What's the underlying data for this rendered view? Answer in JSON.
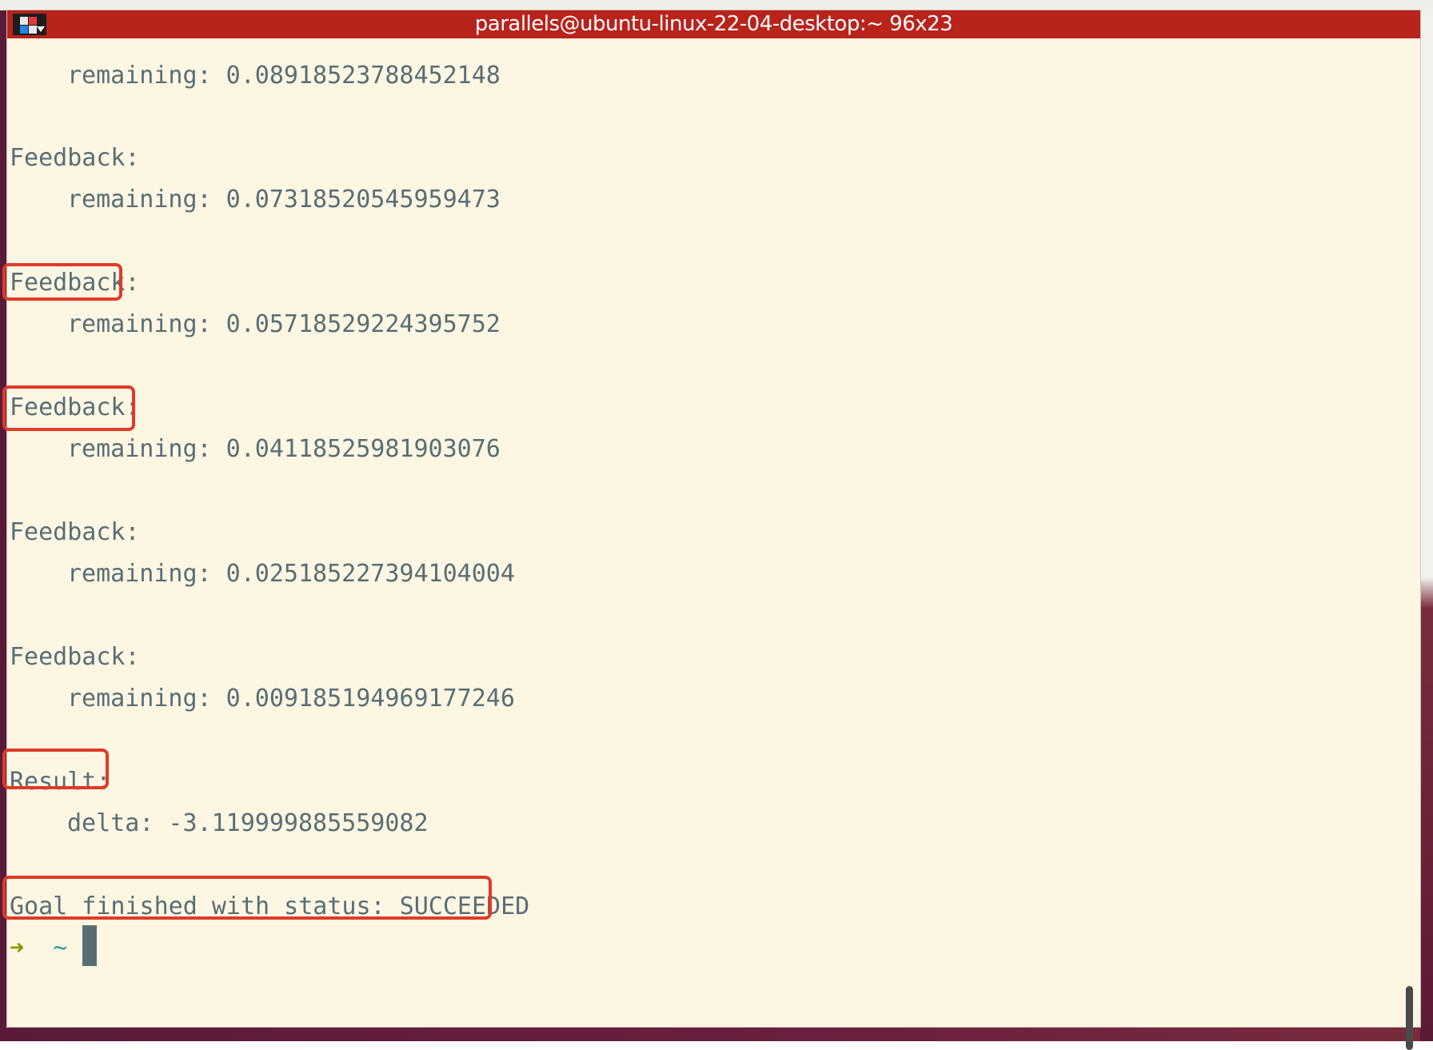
{
  "window": {
    "title": "parallels@ubuntu-linux-22-04-desktop:~ 96x23"
  },
  "terminal": {
    "lines": [
      {
        "text": "remaining: 0.08918523788452148",
        "indent": true
      },
      {
        "text": "Feedback:",
        "indent": false
      },
      {
        "text": "remaining: 0.07318520545959473",
        "indent": true
      },
      {
        "text": "Feedback:",
        "indent": false
      },
      {
        "text": "remaining: 0.05718529224395752",
        "indent": true
      },
      {
        "text": "Feedback:",
        "indent": false
      },
      {
        "text": "remaining: 0.04118525981903076",
        "indent": true
      },
      {
        "text": "Feedback:",
        "indent": false
      },
      {
        "text": "remaining: 0.025185227394104004",
        "indent": true
      },
      {
        "text": "Feedback:",
        "indent": false
      },
      {
        "text": "remaining: 0.009185194969177246",
        "indent": true
      },
      {
        "text": "Result:",
        "indent": false
      },
      {
        "text": "delta: -3.119999885559082",
        "indent": true
      },
      {
        "text": "Goal finished with status: SUCCEEDED",
        "indent": false
      }
    ],
    "prompt": {
      "arrow": "➜",
      "cwd": "~"
    }
  },
  "colors": {
    "titlebar": "#b8231b",
    "terminal_bg": "#fdf6e3",
    "terminal_fg": "#586e75",
    "prompt_arrow": "#859900",
    "prompt_cwd": "#2aa198",
    "annotation_box": "#e03a28"
  },
  "icons": {
    "app_icon": "terminal-window-icon"
  }
}
